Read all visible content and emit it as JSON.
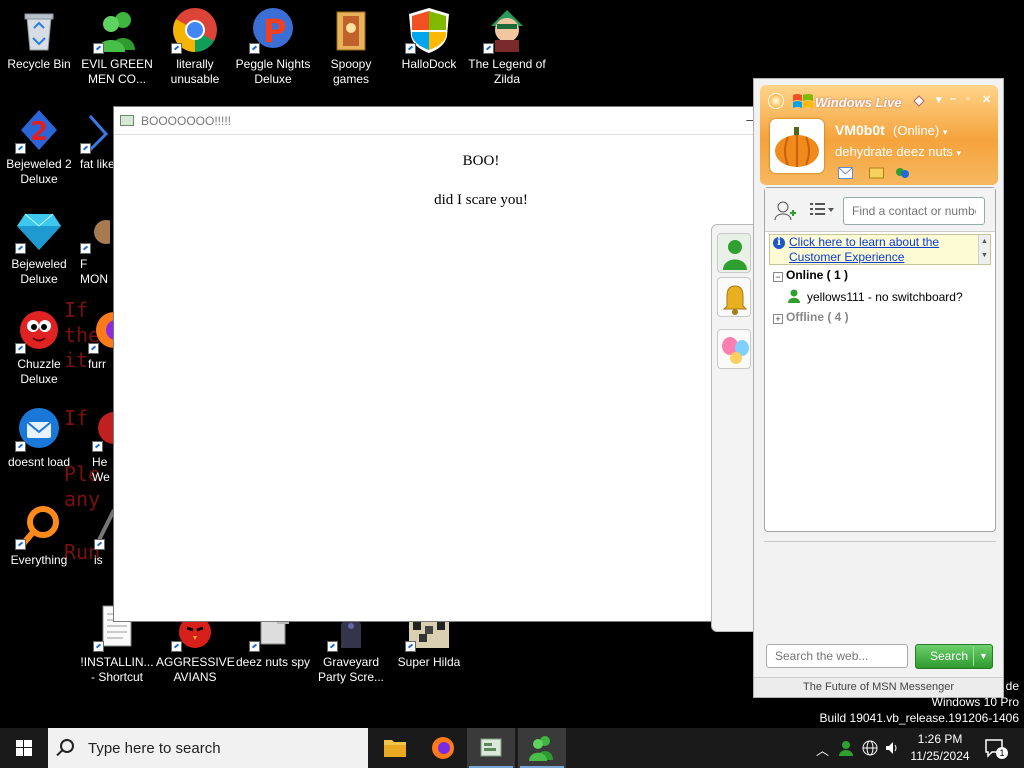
{
  "desktop": {
    "icons": [
      {
        "label": "Recycle Bin"
      },
      {
        "label": "EVIL GREEN MEN CO..."
      },
      {
        "label": "literally unusable"
      },
      {
        "label": "Peggle Nights Deluxe"
      },
      {
        "label": "Spoopy games"
      },
      {
        "label": "HalloDock"
      },
      {
        "label": "The Legend of Zilda"
      },
      {
        "label": "Bejeweled 2 Deluxe"
      },
      {
        "label": "fat like"
      },
      {
        "label": "Bejeweled Deluxe"
      },
      {
        "label": "F MON"
      },
      {
        "label": "Chuzzle Deluxe"
      },
      {
        "label": "furr"
      },
      {
        "label": "doesnt load"
      },
      {
        "label": "He We"
      },
      {
        "label": "Everything"
      },
      {
        "label": "is"
      },
      {
        "label": "!INSTALLIN... - Shortcut"
      },
      {
        "label": "AGGRESSIVE AVIANS"
      },
      {
        "label": "deez nuts spy"
      },
      {
        "label": "Graveyard Party Scre..."
      },
      {
        "label": "Super Hilda"
      }
    ],
    "background_text": [
      "If",
      "the",
      "it",
      "If",
      "Ple",
      "any",
      "Run"
    ]
  },
  "boo_window": {
    "title": "BOOOOOOO!!!!!",
    "line1": "BOO!",
    "line2": "did I scare you!"
  },
  "messenger": {
    "brand": "Windows Live",
    "username": "VM0b0t",
    "status": "(Online)",
    "personal_message": "dehydrate deez nuts",
    "find_placeholder": "Find a contact or number",
    "info_link": "Click here to learn about the Customer Experience",
    "groups": [
      {
        "name": "Online ( 1 )",
        "expanded": true
      },
      {
        "name": "Offline ( 4 )",
        "expanded": false
      }
    ],
    "contacts": [
      {
        "name": "yellows111 - no switchboard?"
      }
    ],
    "web_search_placeholder": "Search the web...",
    "search_button": "Search",
    "footer": "The Future of MSN Messenger"
  },
  "watermark": {
    "line1": "de",
    "line2": "Windows 10 Pro",
    "line3": "Build 19041.vb_release.191206-1406"
  },
  "taskbar": {
    "search_placeholder": "Type here to search",
    "time": "1:26 PM",
    "date": "11/25/2024",
    "notification_count": "1"
  },
  "colors": {
    "msn_orange": "#f5a33c",
    "search_green": "#2e9a2e",
    "link_blue": "#0a3ccf"
  }
}
